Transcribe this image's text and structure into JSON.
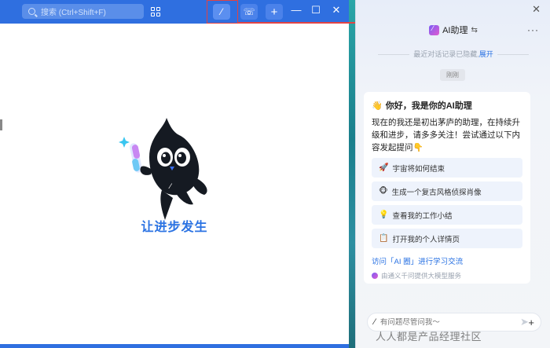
{
  "titlebar": {
    "search_placeholder": "搜索 (Ctrl+Shift+F)",
    "min_glyph": "—",
    "max_glyph": "☐",
    "close_glyph": "✕",
    "plus_glyph": "+",
    "ai_glyph": "⁄",
    "call_glyph": "☏",
    "icons": [
      "search-icon",
      "apps-grid-icon",
      "ai-assistant-icon",
      "call-icon",
      "plus-icon"
    ]
  },
  "main": {
    "slogan": "让进步发生"
  },
  "ai_panel": {
    "title": "AI助理",
    "switch_glyph": "⇆",
    "more_glyph": "···",
    "close_glyph": "✕",
    "history_text": "最近对话记录已隐藏,",
    "history_expand": "展开",
    "time_badge": "刚刚",
    "greeting_emoji": "👋",
    "greeting": "你好，我是你的AI助理",
    "intro": "现在的我还是初出茅庐的助理，在持续升级和进步，请多多关注！尝试通过以下内容发起提问👇",
    "suggestions": [
      {
        "emoji": "🚀",
        "label": "宇宙将如何结束"
      },
      {
        "emoji": "🐵",
        "label": "生成一个复古风格侦探肖像"
      },
      {
        "emoji": "💡",
        "label": "查看我的工作小结"
      },
      {
        "emoji": "📋",
        "label": "打开我的个人详情页"
      }
    ],
    "learn_link": "访问「AI 圈」进行学习交流",
    "model_note": "由通义千问提供大模型服务",
    "input_placeholder": "有问题尽管问我～",
    "input_slash": "⁄",
    "input_plus": "+",
    "send_glyph": "➤"
  },
  "watermark": "人人都是产品经理社区",
  "colors": {
    "titlebar": "#2f6fe0",
    "accent": "#2b73e3",
    "highlight_box": "#e24343"
  }
}
